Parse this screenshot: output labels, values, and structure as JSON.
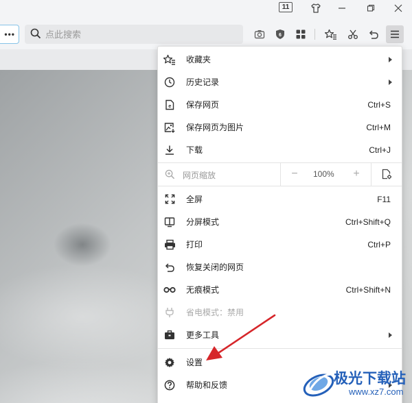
{
  "titlebar": {
    "tab_count": "11"
  },
  "toolbar": {
    "address_fragment": "•••",
    "search_placeholder": "点此搜索"
  },
  "menu": {
    "items_top": [
      {
        "label": "收藏夹",
        "shortcut": "",
        "submenu": true,
        "icon": "star-list-icon"
      },
      {
        "label": "历史记录",
        "shortcut": "",
        "submenu": true,
        "icon": "clock-icon"
      },
      {
        "label": "保存网页",
        "shortcut": "Ctrl+S",
        "submenu": false,
        "icon": "save-page-icon"
      },
      {
        "label": "保存网页为图片",
        "shortcut": "Ctrl+M",
        "submenu": false,
        "icon": "image-save-icon"
      },
      {
        "label": "下载",
        "shortcut": "Ctrl+J",
        "submenu": false,
        "icon": "download-icon"
      }
    ],
    "zoom": {
      "label": "网页缩放",
      "minus": "−",
      "value": "100%",
      "plus": "+"
    },
    "items_mid": [
      {
        "label": "全屏",
        "shortcut": "F11",
        "icon": "fullscreen-icon"
      },
      {
        "label": "分屏模式",
        "shortcut": "Ctrl+Shift+Q",
        "icon": "split-screen-icon"
      },
      {
        "label": "打印",
        "shortcut": "Ctrl+P",
        "icon": "printer-icon"
      },
      {
        "label": "恢复关闭的网页",
        "shortcut": "",
        "icon": "undo-icon"
      },
      {
        "label": "无痕模式",
        "shortcut": "Ctrl+Shift+N",
        "icon": "incognito-icon"
      },
      {
        "label": "省电模式：禁用",
        "shortcut": "",
        "icon": "plug-icon",
        "disabled": true
      },
      {
        "label": "更多工具",
        "shortcut": "",
        "icon": "toolbox-icon",
        "submenu": true
      }
    ],
    "items_bottom": [
      {
        "label": "设置",
        "icon": "gear-icon"
      },
      {
        "label": "帮助和反馈",
        "icon": "help-icon",
        "submenu": true
      }
    ]
  },
  "watermark": {
    "title": "极光下载站",
    "url": "www.xz7.com"
  },
  "colors": {
    "annotation": "#d6262a",
    "watermark": "#2460b9",
    "accent_border": "#86c3e8"
  }
}
